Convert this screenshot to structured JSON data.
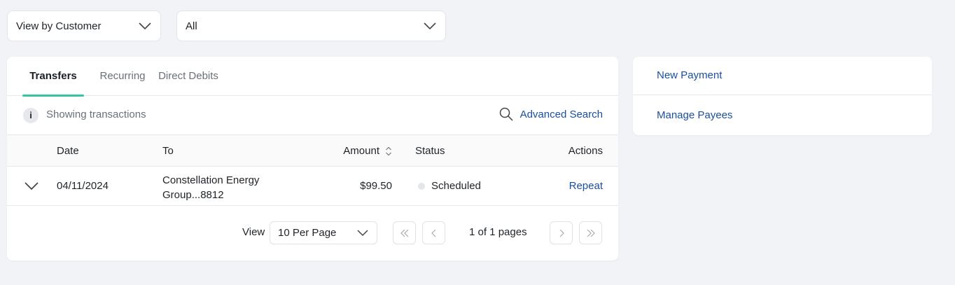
{
  "filters": {
    "view_by": "View by Customer",
    "account": "All"
  },
  "tabs": [
    {
      "label": "Transfers",
      "active": true
    },
    {
      "label": "Recurring",
      "active": false
    },
    {
      "label": "Direct Debits",
      "active": false
    }
  ],
  "info": {
    "icon": "info-icon",
    "glyph": "i",
    "text": "Showing transactions",
    "advanced_search": "Advanced Search"
  },
  "table": {
    "headers": {
      "date": "Date",
      "to": "To",
      "amount": "Amount",
      "status": "Status",
      "actions": "Actions"
    },
    "rows": [
      {
        "date": "04/11/2024",
        "to": "Constellation Energy Group...8812",
        "amount": "$99.50",
        "status": "Scheduled",
        "action": "Repeat"
      }
    ]
  },
  "pagination": {
    "view_label": "View",
    "per_page": "10 Per Page",
    "page_info": "1 of 1 pages"
  },
  "side_menu": {
    "items": [
      {
        "label": "New Payment"
      },
      {
        "label": "Manage Payees"
      }
    ]
  },
  "colors": {
    "accent_tab": "#34c6a3",
    "link": "#1a4f9c",
    "background": "#f1f3f6"
  }
}
